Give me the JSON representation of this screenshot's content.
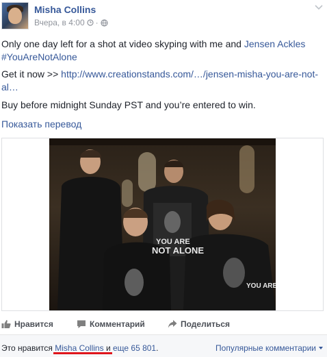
{
  "post": {
    "author": "Misha Collins",
    "timestamp": "Вчера, в 4:00",
    "separator": "·",
    "paragraph1": {
      "text": "Only one day left for a shot at video skyping with me and ",
      "mention": "Jensen Ackles",
      "hashtag": "#YouAreNotAlone"
    },
    "paragraph2": {
      "prefix": "Get it now >> ",
      "link": "http://www.creationstands.com/…/jensen-misha-you-are-not-al…"
    },
    "paragraph3": "Buy before midnight Sunday PST and you’re entered to win.",
    "translate_label": "Показать перевод",
    "photo": {
      "shirt_text_1": "YOU ARE",
      "shirt_text_2": "NOT ALONE"
    }
  },
  "actions": {
    "like": "Нравится",
    "comment": "Комментарий",
    "share": "Поделиться"
  },
  "likes": {
    "prefix": "Это нравится ",
    "name": "Misha Collins",
    "middle": " и ",
    "others": "еще 65 801",
    "suffix": ".",
    "sort_label": "Популярные комментарии"
  },
  "colors": {
    "link": "#365899",
    "meta": "#90949c",
    "highlight": "#e0161c"
  }
}
